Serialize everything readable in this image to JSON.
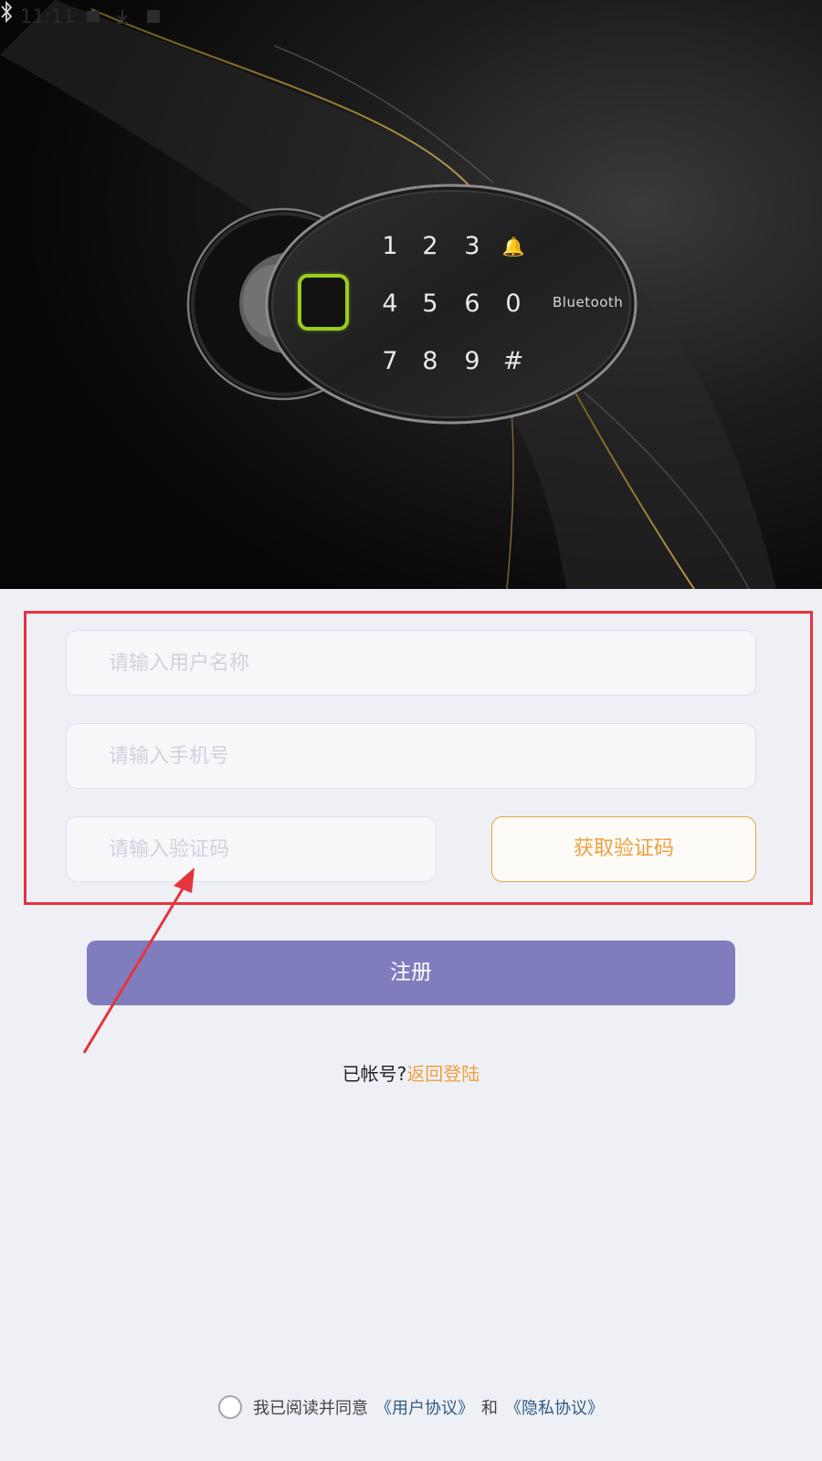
{
  "status_bar": {
    "time": "11:11",
    "left_icons": [
      "image-icon",
      "download-icon",
      "app-icon"
    ],
    "right_icons": [
      "wifi-icon",
      "signal-icon",
      "battery-icon"
    ]
  },
  "hero": {
    "keypad": {
      "keys": [
        "1",
        "2",
        "3",
        "🔔",
        "4",
        "5",
        "6",
        "0",
        "7",
        "8",
        "9",
        "#"
      ],
      "bluetooth_label": "Bluetooth"
    }
  },
  "form": {
    "username_placeholder": "请输入用户名称",
    "phone_placeholder": "请输入手机号",
    "code_placeholder": "请输入验证码",
    "get_code_label": "获取验证码"
  },
  "register_label": "注册",
  "login_prompt": {
    "text": "已帐号?",
    "link": "返回登陆"
  },
  "agreement": {
    "text": "我已阅读并同意",
    "user_agreement": "《用户协议》",
    "conjunction": "和",
    "privacy_policy": "《隐私协议》"
  },
  "colors": {
    "accent_orange": "#eea03f",
    "register_button": "#807dbf",
    "annotation_red": "#e4343e",
    "link_blue": "#2d5a86",
    "page_background": "#eff0f5"
  }
}
